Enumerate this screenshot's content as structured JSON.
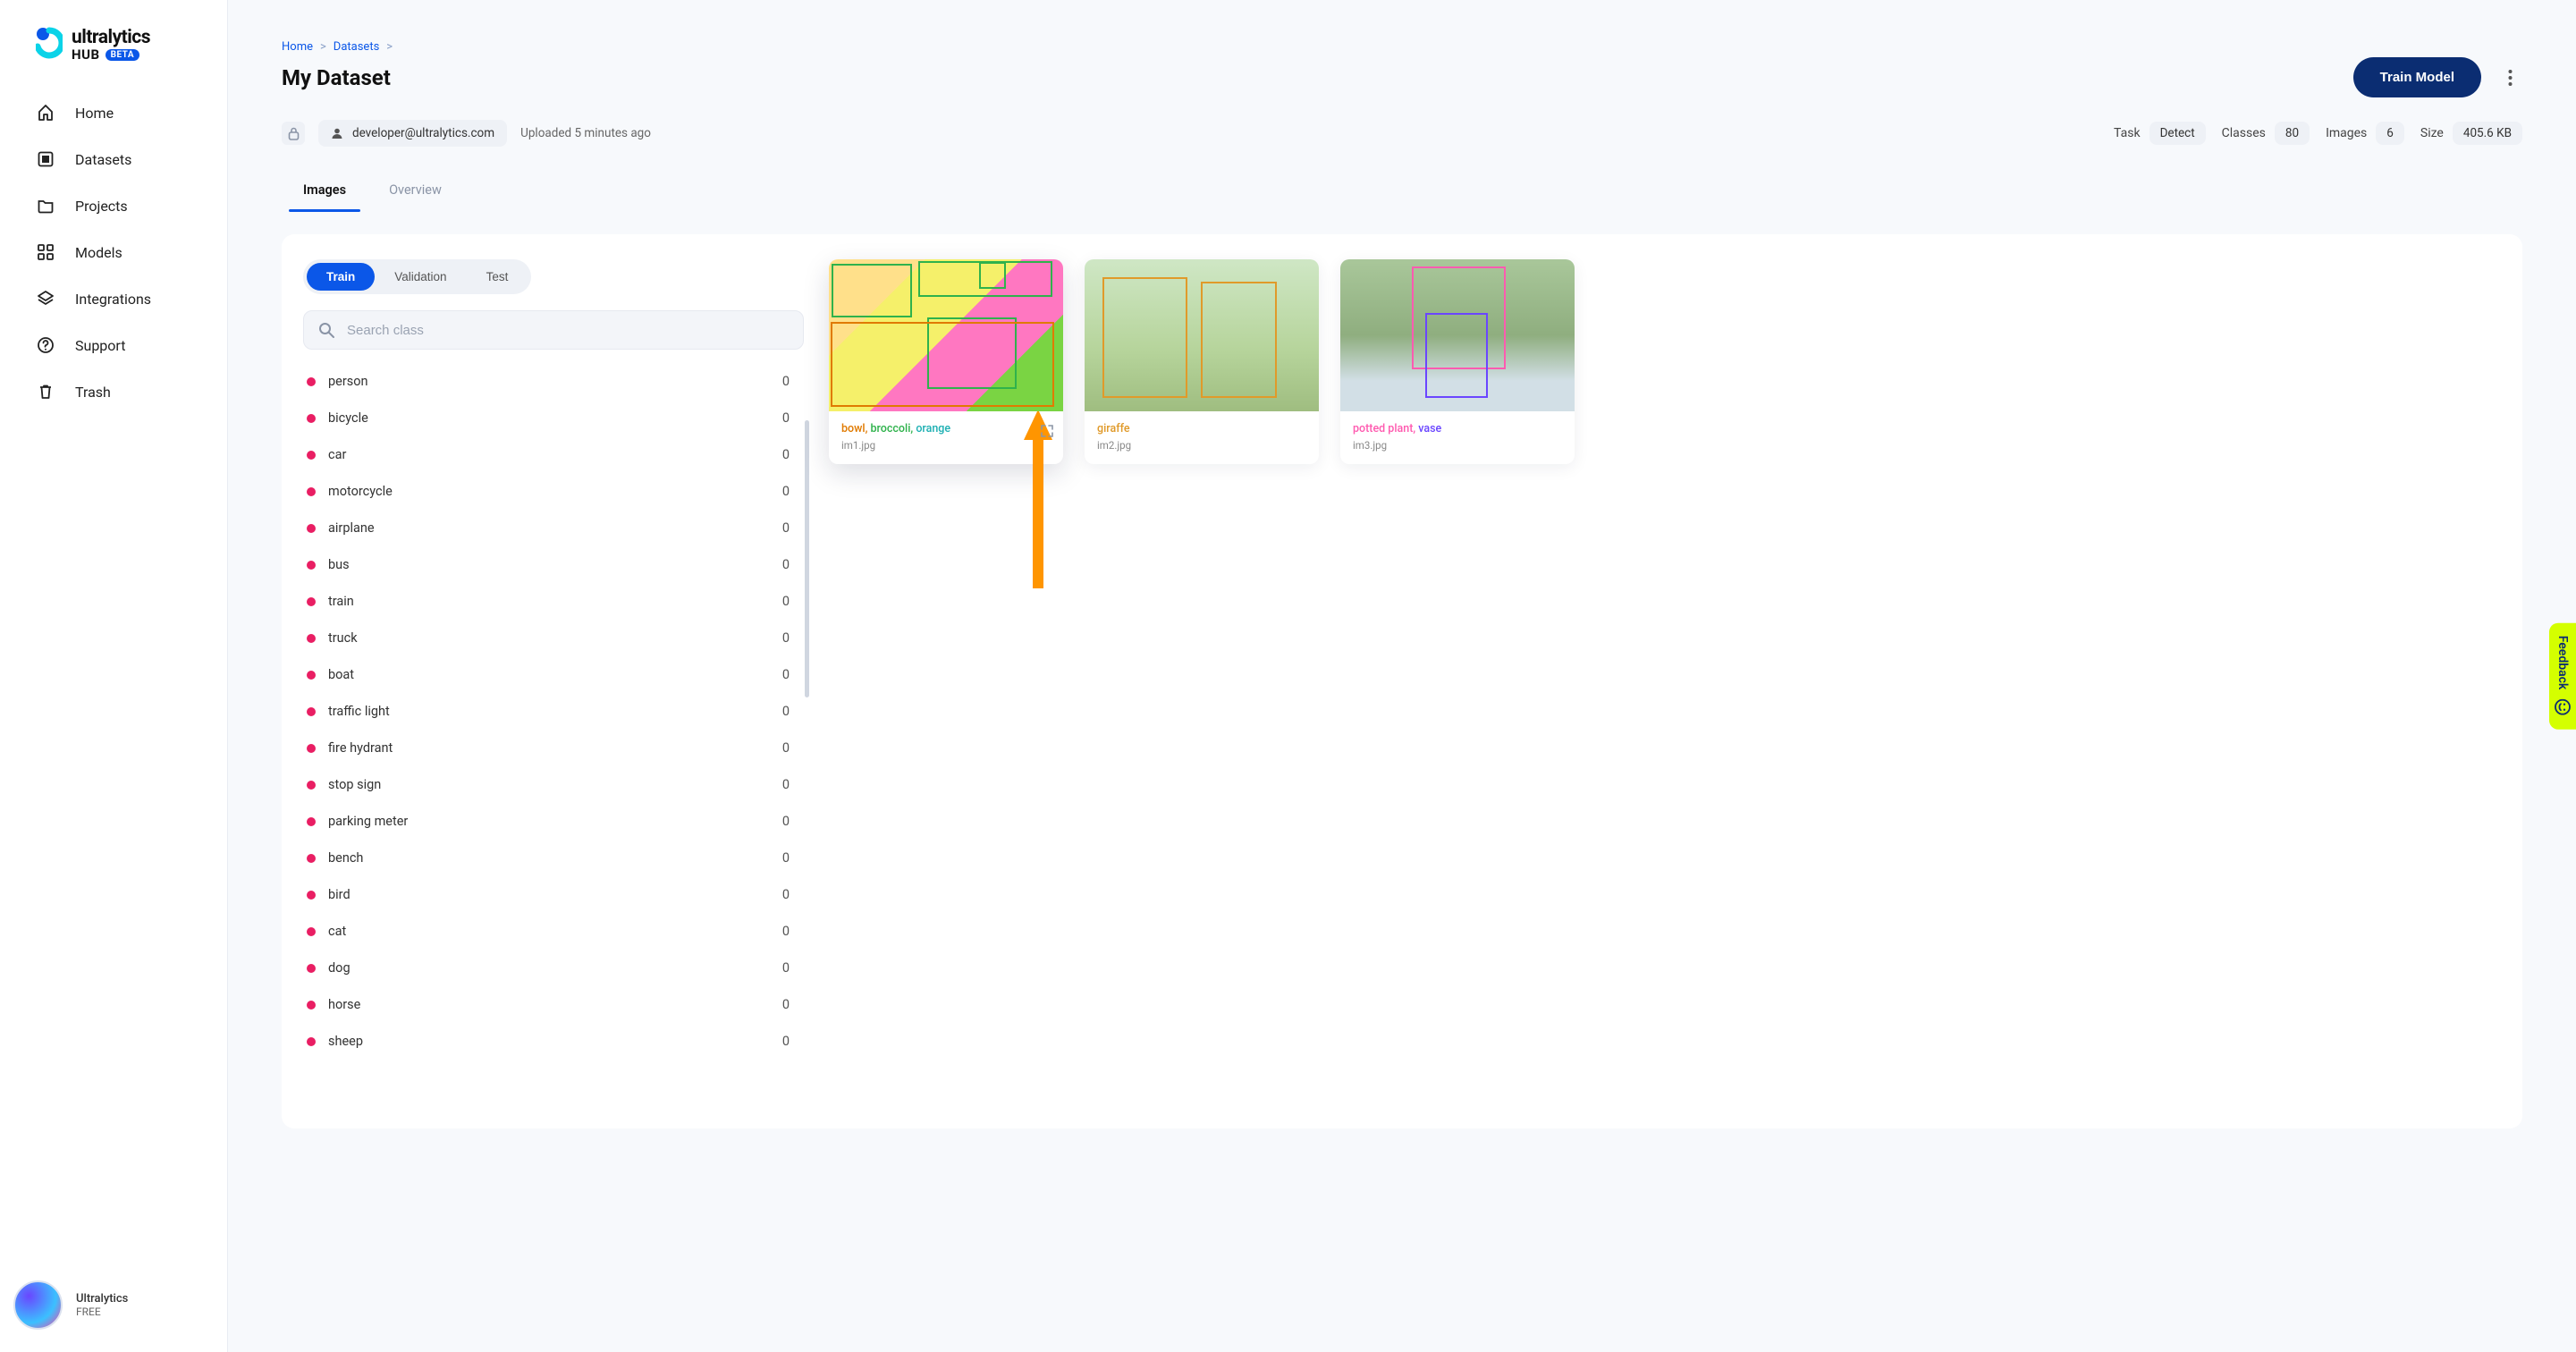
{
  "brand": {
    "name": "ultralytics",
    "sub_word": "HUB",
    "beta": "BETA"
  },
  "nav": [
    {
      "icon": "home",
      "label": "Home"
    },
    {
      "icon": "datasets",
      "label": "Datasets"
    },
    {
      "icon": "projects",
      "label": "Projects"
    },
    {
      "icon": "models",
      "label": "Models"
    },
    {
      "icon": "integrations",
      "label": "Integrations"
    },
    {
      "icon": "support",
      "label": "Support"
    },
    {
      "icon": "trash",
      "label": "Trash"
    }
  ],
  "footer": {
    "line1": "Ultralytics",
    "line2": "FREE"
  },
  "breadcrumbs": [
    "Home",
    "Datasets"
  ],
  "page_title": "My Dataset",
  "train_button": "Train Model",
  "owner_email": "developer@ultralytics.com",
  "uploaded_text": "Uploaded 5 minutes ago",
  "stats": {
    "task_label": "Task",
    "task_value": "Detect",
    "classes_label": "Classes",
    "classes_value": "80",
    "images_label": "Images",
    "images_value": "6",
    "size_label": "Size",
    "size_value": "405.6 KB"
  },
  "tabs": {
    "images": "Images",
    "overview": "Overview"
  },
  "split_tabs": {
    "train": "Train",
    "validation": "Validation",
    "test": "Test"
  },
  "search_placeholder": "Search class",
  "classes": [
    {
      "name": "person",
      "count": 0
    },
    {
      "name": "bicycle",
      "count": 0
    },
    {
      "name": "car",
      "count": 0
    },
    {
      "name": "motorcycle",
      "count": 0
    },
    {
      "name": "airplane",
      "count": 0
    },
    {
      "name": "bus",
      "count": 0
    },
    {
      "name": "train",
      "count": 0
    },
    {
      "name": "truck",
      "count": 0
    },
    {
      "name": "boat",
      "count": 0
    },
    {
      "name": "traffic light",
      "count": 0
    },
    {
      "name": "fire hydrant",
      "count": 0
    },
    {
      "name": "stop sign",
      "count": 0
    },
    {
      "name": "parking meter",
      "count": 0
    },
    {
      "name": "bench",
      "count": 0
    },
    {
      "name": "bird",
      "count": 0
    },
    {
      "name": "cat",
      "count": 0
    },
    {
      "name": "dog",
      "count": 0
    },
    {
      "name": "horse",
      "count": 0
    },
    {
      "name": "sheep",
      "count": 0
    }
  ],
  "images": [
    {
      "file": "im1.jpg",
      "tags": [
        {
          "text": "bowl",
          "color": "#e07a00"
        },
        {
          "text": "broccoli",
          "color": "#2fb24c"
        },
        {
          "text": "orange",
          "color": "#1eb0b3"
        }
      ],
      "hover": true,
      "expand": true
    },
    {
      "file": "im2.jpg",
      "tags": [
        {
          "text": "giraffe",
          "color": "#e09a2a"
        }
      ],
      "hover": false,
      "expand": false
    },
    {
      "file": "im3.jpg",
      "tags": [
        {
          "text": "potted plant",
          "color": "#ff5bb0"
        },
        {
          "text": "vase",
          "color": "#6a46ff"
        }
      ],
      "hover": false,
      "expand": false
    }
  ],
  "feedback_label": "Feedback"
}
